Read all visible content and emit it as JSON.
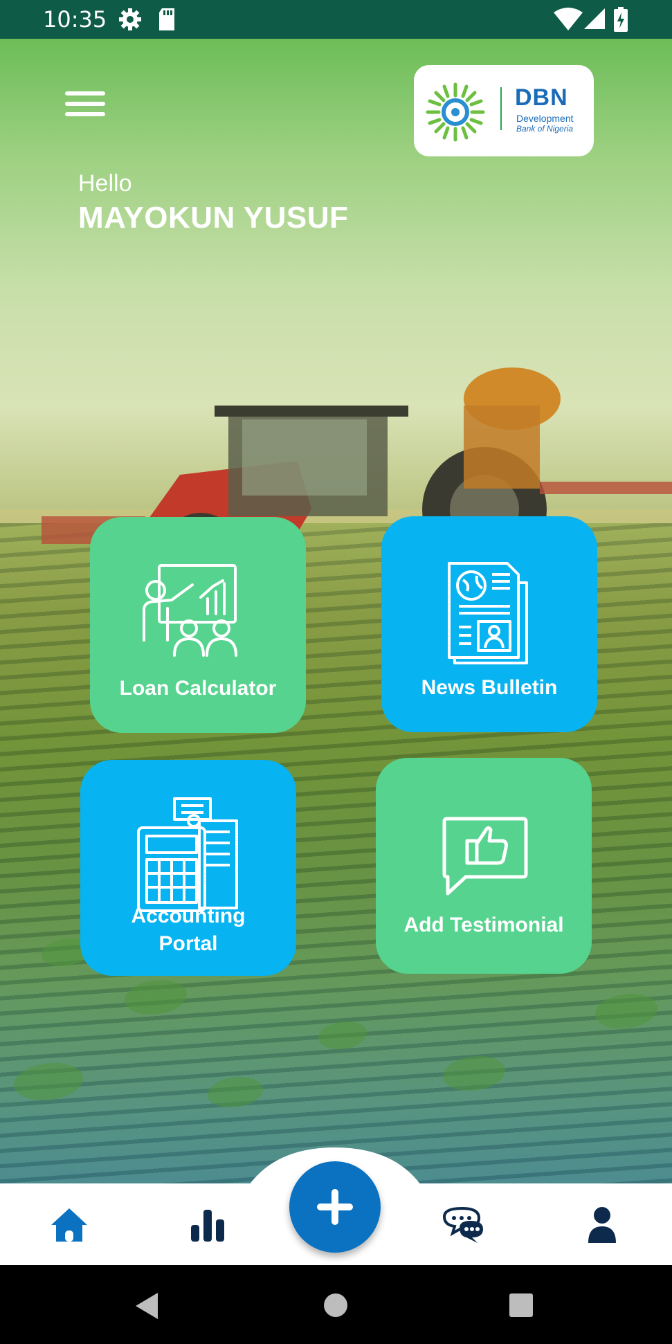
{
  "status_bar": {
    "time": "10:35",
    "icons": [
      "settings-icon",
      "sd-card-icon",
      "wifi-icon",
      "cell-signal-icon",
      "battery-charging-icon"
    ]
  },
  "header": {
    "menu_icon": "hamburger-menu-icon",
    "logo": {
      "abbr": "DBN",
      "name_line1": "Development",
      "name_line2": "Bank of Nigeria"
    }
  },
  "greeting": {
    "hello": "Hello",
    "user_name": "MAYOKUN YUSUF"
  },
  "tiles": [
    {
      "label": "Loan Calculator",
      "icon": "presentation-chart-icon",
      "color": "#56d38e"
    },
    {
      "label": "News Bulletin",
      "icon": "newspaper-icon",
      "color": "#07b3f0"
    },
    {
      "label_line1": "Accounting",
      "label_line2": "Portal",
      "icon": "calculator-documents-icon",
      "color": "#07b3f0"
    },
    {
      "label": "Add Testimonial",
      "icon": "thumbs-up-message-icon",
      "color": "#56d38e"
    }
  ],
  "bottom_nav": {
    "items": [
      "home-icon",
      "stats-bar-icon",
      "add-icon",
      "chat-icon",
      "profile-icon"
    ],
    "active": "home-icon",
    "active_color": "#0a72c0",
    "inactive_color": "#0d2a4d"
  },
  "system_nav": [
    "back-icon",
    "home-circle-icon",
    "recents-icon"
  ]
}
